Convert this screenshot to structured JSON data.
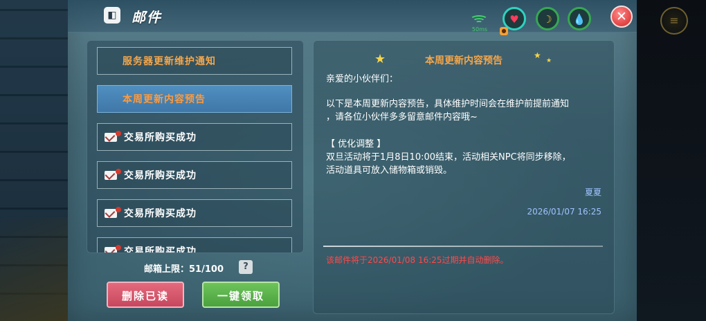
{
  "header": {
    "title": "邮件",
    "close_glyph": "✕"
  },
  "status": {
    "ping": "50ms",
    "icons": [
      "heart-icon",
      "hunger-icon",
      "water-drop-icon"
    ]
  },
  "mail_list": {
    "items": [
      {
        "label": "服务器更新维护通知",
        "type": "system",
        "selected": false
      },
      {
        "label": "本周更新内容预告",
        "type": "system",
        "selected": true
      },
      {
        "label": "交易所购买成功",
        "type": "trade",
        "selected": false
      },
      {
        "label": "交易所购买成功",
        "type": "trade",
        "selected": false
      },
      {
        "label": "交易所购买成功",
        "type": "trade",
        "selected": false
      },
      {
        "label": "交易所购买成功",
        "type": "trade",
        "selected": false
      }
    ],
    "capacity_label": "邮箱上限：",
    "capacity_value": "51/100",
    "help": "?"
  },
  "actions": {
    "delete_read": "删除已读",
    "collect_all": "一键领取"
  },
  "mail_detail": {
    "title": "本周更新内容预告",
    "greeting": "亲爱的小伙伴们：",
    "paragraph1_line1": "以下是本周更新内容预告，具体维护时间会在维护前提前通知",
    "paragraph1_line2": "，请各位小伙伴多多留意邮件内容哦~",
    "section_title": "【 优化调整 】",
    "section_line1": "双旦活动将于1月8日10:00结束，活动相关NPC将同步移除，",
    "section_line2": "活动道具可放入储物箱或销毁。",
    "sender": "夏夏",
    "timestamp": "2026/01/07 16:25",
    "expire_note": "该邮件将于2026/01/08 16:25过期并自动删除。"
  },
  "colors": {
    "accent_orange": "#f5a64a",
    "selected_blue": "#4f8fc0",
    "link_blue": "#9fc3ff",
    "warning_red": "#ff4a4a"
  }
}
